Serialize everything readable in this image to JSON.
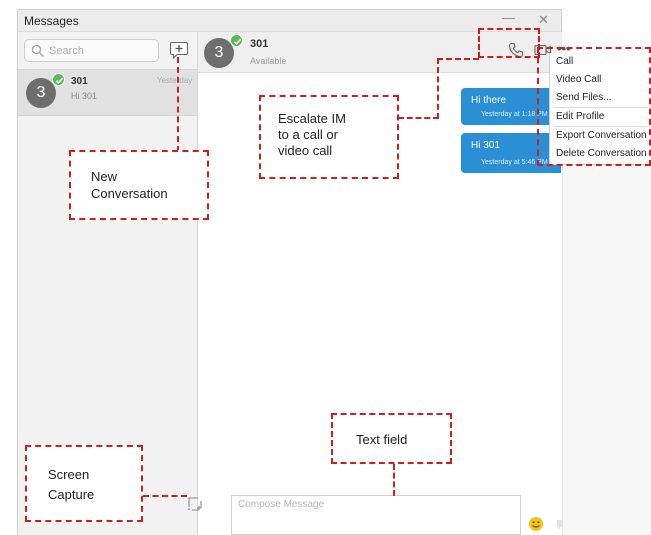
{
  "window": {
    "title": "Messages",
    "minimize_glyph": "—",
    "close_glyph": "✕"
  },
  "sidebar": {
    "search_placeholder": "Search",
    "conversations": [
      {
        "avatar_text": "3",
        "name": "301",
        "preview": "Hi 301",
        "time": "Yesterday"
      }
    ]
  },
  "chat": {
    "header": {
      "avatar_text": "3",
      "name": "301",
      "status": "Available",
      "more_glyph": "•••"
    },
    "messages": [
      {
        "text": "Hi there",
        "time": "Yesterday at 1:18 PM"
      },
      {
        "text": "Hi 301",
        "time": "Yesterday at 5:46 PM"
      }
    ],
    "compose_placeholder": "Compose Message"
  },
  "context_menu": {
    "items": [
      "Call",
      "Video Call",
      "Send Files...",
      "Edit Profile",
      "Export Conversation",
      "Delete Conversation"
    ]
  },
  "annotations": {
    "escalate": [
      "Escalate IM",
      "to a call or",
      "video call"
    ],
    "new_conversation": [
      "New",
      "Conversation"
    ],
    "text_field": "Text field",
    "screen_capture": [
      "Screen",
      "Capture"
    ]
  },
  "colors": {
    "accent_blue": "#2b8fd6",
    "presence_green": "#5cb85c",
    "annotation_red": "#cc1f1f",
    "avatar_gray": "#6e6e6e"
  },
  "icons": [
    "search-icon",
    "new-conversation-icon",
    "presence-check-icon",
    "call-icon",
    "video-icon",
    "more-icon",
    "screen-capture-icon",
    "emoji-icon",
    "send-icon"
  ]
}
